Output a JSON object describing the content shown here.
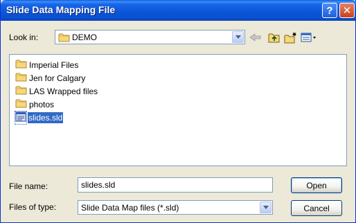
{
  "window": {
    "title": "Slide Data Mapping File"
  },
  "titlebar": {
    "help_glyph": "?",
    "close_glyph": "✕"
  },
  "look_in": {
    "label": "Look in:",
    "value": "DEMO"
  },
  "toolbar": {
    "icons": [
      "back-arrow-icon",
      "up-one-level-icon",
      "create-new-folder-icon",
      "view-menu-icon"
    ]
  },
  "files": [
    {
      "name": "Imperial Files",
      "type": "folder"
    },
    {
      "name": "Jen for Calgary",
      "type": "folder"
    },
    {
      "name": "LAS Wrapped files",
      "type": "folder"
    },
    {
      "name": "photos",
      "type": "folder"
    },
    {
      "name": "slides.sld",
      "type": "file",
      "selected": true
    }
  ],
  "file_name": {
    "label": "File name:",
    "value": "slides.sld"
  },
  "file_type": {
    "label": "Files of type:",
    "value": "Slide Data Map files (*.sld)"
  },
  "buttons": {
    "open": "Open",
    "cancel": "Cancel"
  },
  "colors": {
    "titlebar": "#0a55d8",
    "selection": "#316ac5",
    "dialog_bg": "#ece9d8",
    "folder": "#f5d87a"
  }
}
